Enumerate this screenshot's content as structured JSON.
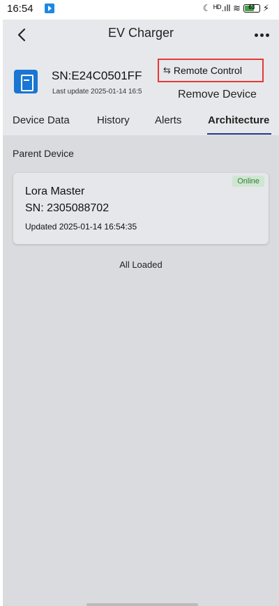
{
  "status_bar": {
    "time": "16:54",
    "icons": "☾ ᴴᴰ.ıll ≋",
    "battery_level": "63"
  },
  "header": {
    "title": "EV Charger"
  },
  "device": {
    "sn": "SN:E24C0501FF",
    "last_update": "Last update 2025-01-14 16:5",
    "remote_control_label": "Remote Control",
    "remove_device_label": "Remove Device"
  },
  "tabs": [
    {
      "label": "Device Data",
      "active": false
    },
    {
      "label": "History",
      "active": false
    },
    {
      "label": "Alerts",
      "active": false
    },
    {
      "label": "Architecture",
      "active": true
    }
  ],
  "content": {
    "section_label": "Parent Device",
    "parent_device": {
      "status": "Online",
      "name": "Lora Master",
      "sn": "SN: 2305088702",
      "updated": "Updated 2025-01-14 16:54:35"
    },
    "footer_text": "All Loaded"
  },
  "colors": {
    "accent": "#1976d2",
    "highlight_box": "#e53935",
    "online_badge_bg": "#cfe6d2",
    "online_badge_text": "#2e7d32"
  }
}
